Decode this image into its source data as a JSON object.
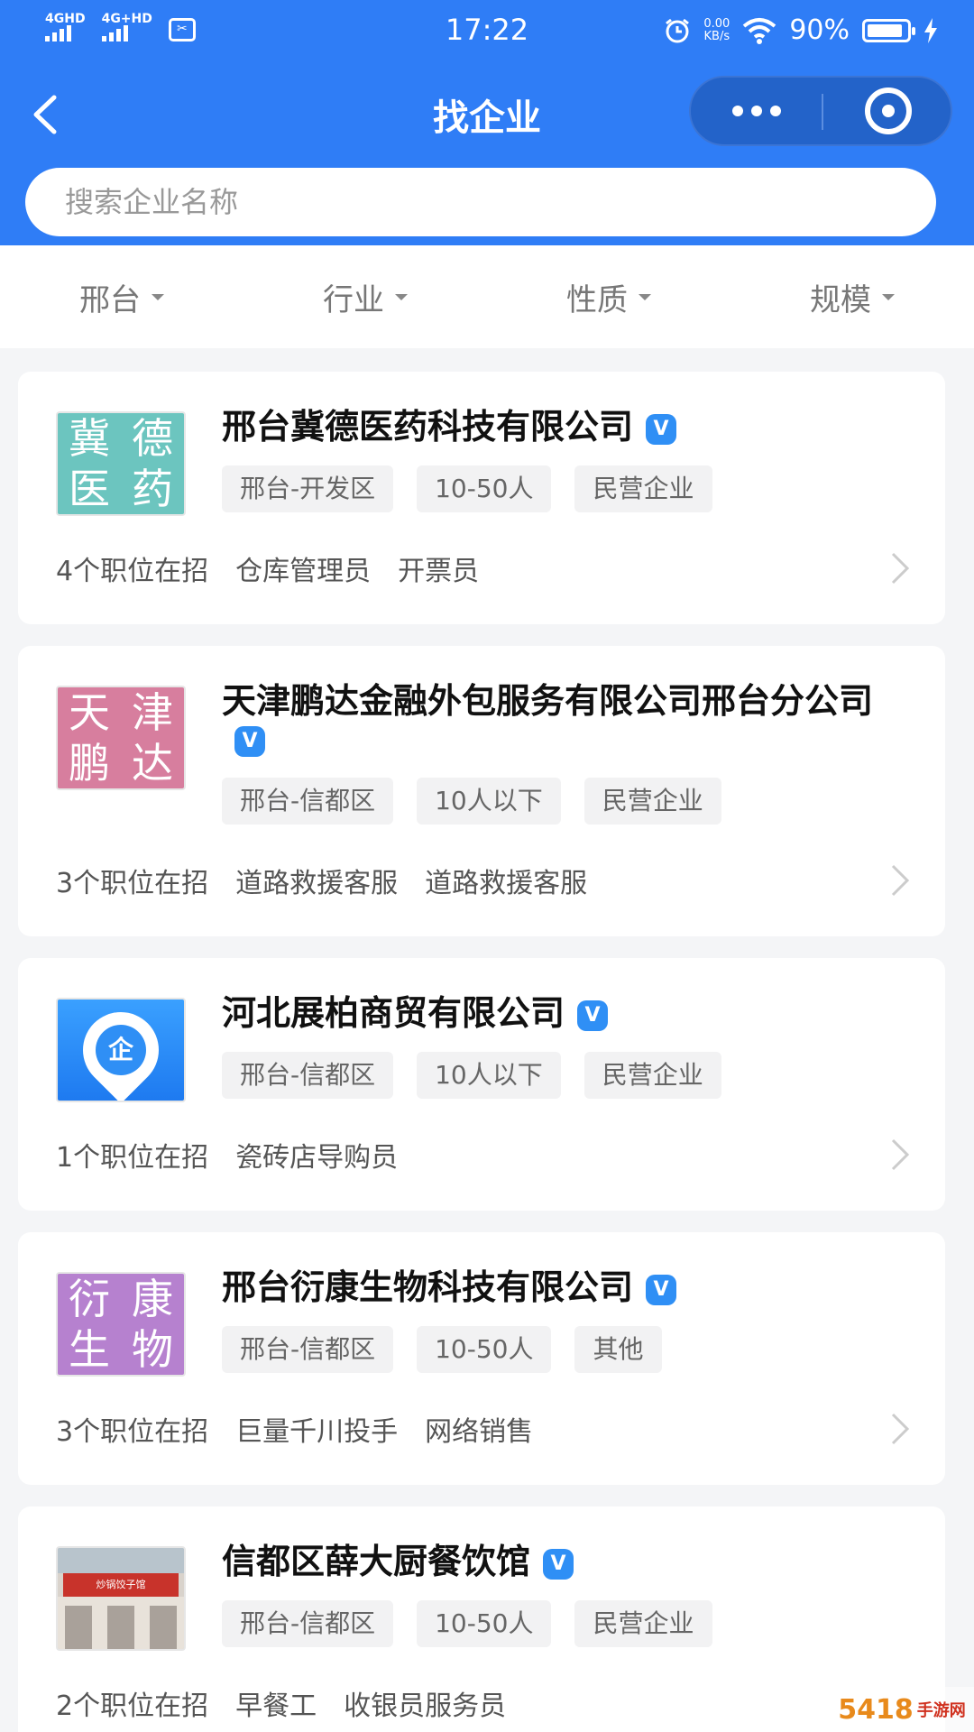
{
  "status_bar": {
    "signal1": "4GHD",
    "signal2": "4G+HD",
    "sim": "✂",
    "time": "17:22",
    "net_speed_value": "0.00",
    "net_speed_unit": "KB/s",
    "battery": "90%",
    "battery_level": 0.9
  },
  "title_bar": {
    "title": "找企业"
  },
  "search": {
    "placeholder": "搜索企业名称"
  },
  "filters": [
    "邢台",
    "行业",
    "性质",
    "规模"
  ],
  "companies": [
    {
      "name": "邢台冀德医药科技有限公司",
      "logo_chars": [
        "冀",
        "德",
        "医",
        "药"
      ],
      "logo_color": "#6cc5bf",
      "tags": [
        "邢台-开发区",
        "10-50人",
        "民营企业"
      ],
      "jobs_count": "4个职位在招",
      "jobs": [
        "仓库管理员",
        "开票员"
      ]
    },
    {
      "name": "天津鹏达金融外包服务有限公司邢台分公司",
      "logo_chars": [
        "天",
        "津",
        "鹏",
        "达"
      ],
      "logo_color": "#d77e9e",
      "tags": [
        "邢台-信都区",
        "10人以下",
        "民营企业"
      ],
      "jobs_count": "3个职位在招",
      "jobs": [
        "道路救援客服",
        "道路救援客服"
      ]
    },
    {
      "name": "河北展柏商贸有限公司",
      "logo_text": "企",
      "tags": [
        "邢台-信都区",
        "10人以下",
        "民营企业"
      ],
      "jobs_count": "1个职位在招",
      "jobs": [
        "瓷砖店导购员"
      ]
    },
    {
      "name": "邢台衍康生物科技有限公司",
      "logo_chars": [
        "衍",
        "康",
        "生",
        "物"
      ],
      "logo_color": "#b681cf",
      "tags": [
        "邢台-信都区",
        "10-50人",
        "其他"
      ],
      "jobs_count": "3个职位在招",
      "jobs": [
        "巨量千川投手",
        "网络销售"
      ]
    },
    {
      "name": "信都区薛大厨餐饮馆",
      "logo_sign": "炒锅饺子馆",
      "tags": [
        "邢台-信都区",
        "10-50人",
        "民营企业"
      ],
      "jobs_count": "2个职位在招",
      "jobs": [
        "早餐工",
        "收银员服务员"
      ]
    }
  ],
  "verified_mark": "V",
  "watermark": {
    "main": "5418",
    "sub": "手游网"
  },
  "colors": {
    "header_blue": "#2f7df6",
    "verified_blue": "#2f8ff5"
  }
}
